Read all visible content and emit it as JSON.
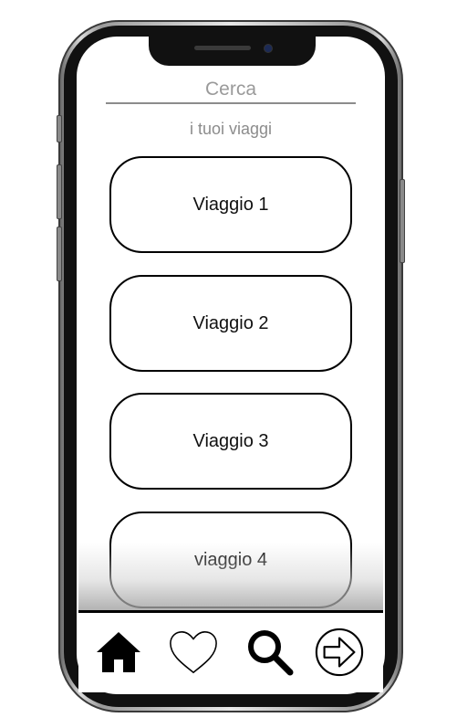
{
  "search": {
    "label": "Cerca"
  },
  "trips": {
    "title": "i tuoi viaggi",
    "items": [
      {
        "label": "Viaggio 1"
      },
      {
        "label": "Viaggio 2"
      },
      {
        "label": "Viaggio 3"
      },
      {
        "label": "viaggio 4"
      }
    ]
  },
  "nav": {
    "items": [
      {
        "icon": "home-icon"
      },
      {
        "icon": "heart-icon"
      },
      {
        "icon": "search-icon"
      },
      {
        "icon": "login-arrow-icon"
      }
    ]
  },
  "colors": {
    "placeholder_text": "#9a9a9a",
    "outline": "#000000",
    "background": "#ffffff"
  }
}
